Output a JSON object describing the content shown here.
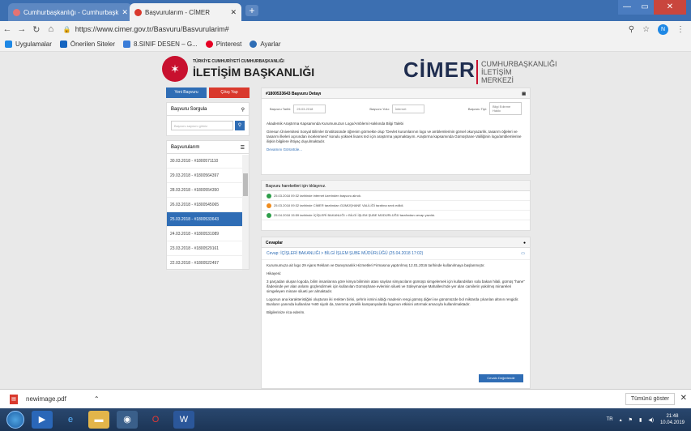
{
  "browser": {
    "tabs": [
      {
        "label": "Cumhurbaşkanlığı - Cumhurbaşk",
        "close": "✕"
      },
      {
        "label": "Başvurularım - CİMER",
        "close": "✕"
      }
    ],
    "new_tab": "+",
    "url": "https://www.cimer.gov.tr/Basvuru/Basvurularim#",
    "bookmarks": [
      "Uygulamalar",
      "Önerilen Siteler",
      "8.SINIF DESEN – G...",
      "Pinterest",
      "Ayarlar"
    ],
    "avatar": "N"
  },
  "brand": {
    "seal_sub": "TÜRKİYE CUMHURİYETİ CUMHURBAŞKANLIĞI",
    "seal_main": "İLETİŞİM BAŞKANLIĞI",
    "cimer": "CİMER",
    "cimer_sub": "CUMHURBAŞKANLIĞI İLETİŞİM MERKEZİ"
  },
  "sidebar": {
    "new_button": "Yeni Başvuru",
    "logout_button": "Çıkış Yap",
    "search_title": "Başvuru Sorgula",
    "search_placeholder": "Başvuru sayısını giriniz",
    "list_title": "Başvurularım",
    "items": [
      {
        "label": "30.03.2018 - #1800571110"
      },
      {
        "label": "29.03.2018 - #1800564397"
      },
      {
        "label": "28.03.2018 - #1800554350"
      },
      {
        "label": "26.03.2018 - #1800545065"
      },
      {
        "label": "25.03.2018 - #1800533643"
      },
      {
        "label": "24.03.2018 - #1800531089"
      },
      {
        "label": "23.03.2018 - #1800529161"
      },
      {
        "label": "22.03.2018 - #1800522497"
      }
    ]
  },
  "detail": {
    "title": "#1800533643 Başvuru Detayı",
    "date_label": "Başvuru Tarihi:",
    "date_value": "25.03.2018",
    "channel_label": "Başvuru Yolu:",
    "channel_value": "İnternet",
    "type_label": "Başvuru Tipi:",
    "type_value": "Bilgi Edinme Hakkı",
    "subject": "Akademik Araştırma Kapsamında Kurumunuzun Logo/Amblemi Hakkında Bilgi Talebi",
    "text": "Giresun Üniversitesi Sosyal Bilimler Enstitüsünde öğrenim görmekte olup “Devlet kurumlarının logo ve amblemlerinin görsel okuryazarlık, tasarım öğeleri ve tasarım ilkeleri açısından incelenmesi” konulu yüksek lisans tezi için araştırma yapmaktayım. Araştırma kapsamında Gümüşhane Valiliğinin logo/amblemlerine ilişkin bilgilere ihtiyaç duyulmaktadır.",
    "more": "Devamını Görüntüle..."
  },
  "history": {
    "title": "Başvuru hareketleri için tıklayınız.",
    "rows": [
      {
        "text": "25.03.2018 09:32 tarihinde internet üzerinden başvuru alındı."
      },
      {
        "text": "25.03.2018 09:32 tarihinde CİMER tarafından GÜMÜŞHANE VALİLİĞİ tarafına sevk edildi."
      },
      {
        "text": "25.04.2018 15:59 tarihinde İÇİŞLERİ BAKANLIĞI > BİLGİ İŞLEM ŞUBE MÜDÜRLÜĞÜ tarafından cevap yazıldı."
      }
    ]
  },
  "answers": {
    "title": "Cevaplar",
    "answer_title": "Cevap: İÇİŞLERİ BAKANLIĞI > BİLGİ İŞLEM ŞUBE MÜDÜRLÜĞÜ (25.04.2018 17:02)",
    "p1": "Kurumumuza ait logo 29 Ajans Reklam ve Danışmanlık Hizmetleri Firmasına yaptırılmış 12.01.2016 tarihinde kullanılmaya başlanmıştır.",
    "p2": "Hikayesi:",
    "p3": "3 parçadan oluşan logoda, bilim insanlarına göre kimya biliminin atası sayılan simyacıların gümüşü simgelemek için kullandıkları sola bakan hilali, gümüş “hane” ifadesinde yer alan anlamı güçlendirmek için kullanılan Gümüşhane evlerinin silueti ve Süleymaniye Mahallesi'nde yer alan camilerin yakılmış minareleri simgeleyen minare silueti yer almaktadır.",
    "p4": "Logonun ana karakteristiğini oluşturan iki renkten birisi, şehrin ismini aldığı madenin rengi gümüş diğeri ise günümüzde bol miktarda çıkarılan altının rengidir. Bunların yanında kullanılan %90 siyah da, tanıtıma yönelik kampanyalarda logonun etkisini artırmak amacıyla kullanılmaktadır.",
    "p5": "Bilgilerinize rica ederim.",
    "eval_button": "Cevabı Değerlendir"
  },
  "download": {
    "file": "newimage.pdf",
    "show_all": "Tümünü göster"
  },
  "taskbar": {
    "lang": "TR",
    "time": "21:48",
    "date": "10.04.2019"
  }
}
